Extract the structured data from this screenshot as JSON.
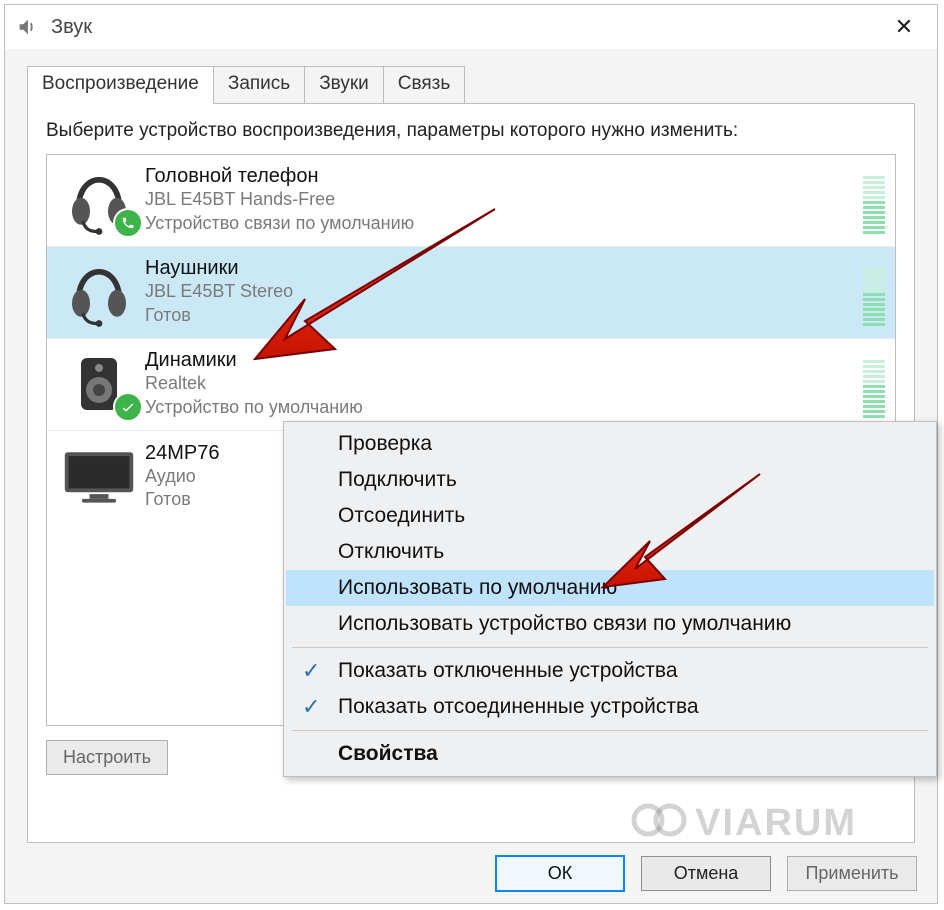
{
  "window": {
    "title": "Звук",
    "close_glyph": "✕"
  },
  "tabs": [
    {
      "label": "Воспроизведение",
      "active": true
    },
    {
      "label": "Запись",
      "active": false
    },
    {
      "label": "Звуки",
      "active": false
    },
    {
      "label": "Связь",
      "active": false
    }
  ],
  "instruction": "Выберите устройство воспроизведения, параметры которого нужно изменить:",
  "devices": [
    {
      "name": "Головной телефон",
      "sub1": "JBL E45BT Hands-Free",
      "sub2": "Устройство связи по умолчанию",
      "icon": "headset",
      "badge": "phone",
      "selected": false
    },
    {
      "name": "Наушники",
      "sub1": "JBL E45BT Stereo",
      "sub2": "Готов",
      "icon": "headset",
      "badge": null,
      "selected": true
    },
    {
      "name": "Динамики",
      "sub1": "Realtek",
      "sub2": "Устройство по умолчанию",
      "icon": "speaker",
      "badge": "check",
      "selected": false
    },
    {
      "name": "24MP76",
      "sub1": "Аудио",
      "sub2": "Готов",
      "icon": "monitor",
      "badge": null,
      "selected": false
    }
  ],
  "buttons": {
    "configure": "Настроить",
    "ok": "ОК",
    "cancel": "Отмена",
    "apply": "Применить"
  },
  "context_menu": {
    "items": [
      {
        "label": "Проверка",
        "type": "item"
      },
      {
        "label": "Подключить",
        "type": "item"
      },
      {
        "label": "Отсоединить",
        "type": "item"
      },
      {
        "label": "Отключить",
        "type": "item"
      },
      {
        "label": "Использовать по умолчанию",
        "type": "item",
        "highlight": true
      },
      {
        "label": "Использовать устройство связи по умолчанию",
        "type": "item"
      },
      {
        "type": "sep"
      },
      {
        "label": "Показать отключенные устройства",
        "type": "item",
        "checked": true
      },
      {
        "label": "Показать отсоединенные устройства",
        "type": "item",
        "checked": true
      },
      {
        "type": "sep"
      },
      {
        "label": "Свойства",
        "type": "item",
        "bold": true
      }
    ]
  },
  "watermark": "VIARUM"
}
